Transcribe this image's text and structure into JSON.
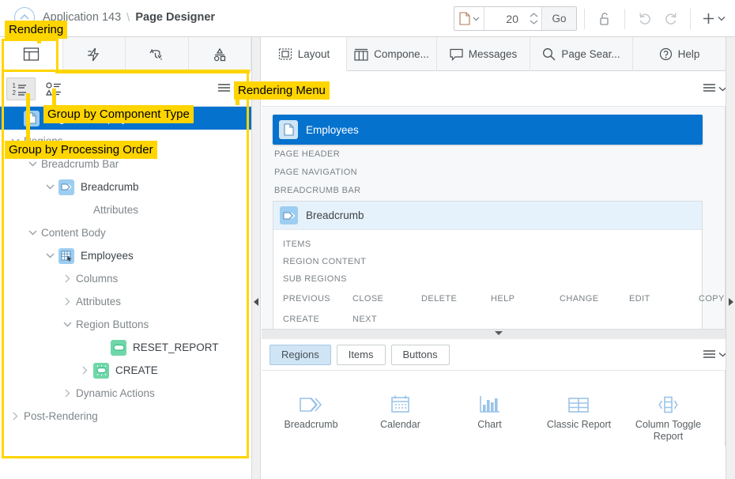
{
  "window": {
    "breadcrumb_app": "Application 143",
    "breadcrumb_sep": "\\",
    "breadcrumb_current": "Page Designer"
  },
  "toolbar": {
    "page_icon": "page-icon",
    "page_number": "20",
    "go_label": "Go",
    "lock_icon": "unlock-icon",
    "undo_icon": "undo-icon",
    "redo_icon": "redo-icon",
    "add_icon": "plus-icon"
  },
  "left_panel": {
    "tabs": [
      {
        "name": "rendering",
        "icon": "rendering-grid-icon",
        "active": true
      },
      {
        "name": "dynamic-actions",
        "icon": "lightning-icon",
        "active": false
      },
      {
        "name": "processing",
        "icon": "process-arrows-icon",
        "active": false
      },
      {
        "name": "page-shared-components",
        "icon": "shapes-icon",
        "active": false
      }
    ],
    "toolbar": {
      "group_processing_order_icon": "ordered-list-icon",
      "group_component_type_icon": "shapes-list-icon",
      "menu_icon": "hamburger-menu-icon"
    },
    "tree": [
      {
        "label": "Page 20: Employees",
        "indent": 0,
        "toggle": "none",
        "icon": "page-icon",
        "icon_color": "blue",
        "selected": true,
        "dark": true
      },
      {
        "label": "Regions",
        "indent": 0,
        "toggle": "down",
        "icon": "none",
        "icon_color": "plain",
        "selected": false,
        "dark": false
      },
      {
        "label": "Breadcrumb Bar",
        "indent": 1,
        "toggle": "down",
        "icon": "none",
        "icon_color": "plain",
        "selected": false,
        "dark": false
      },
      {
        "label": "Breadcrumb",
        "indent": 2,
        "toggle": "down",
        "icon": "breadcrumb-icon",
        "icon_color": "blue",
        "selected": false,
        "dark": true
      },
      {
        "label": "Attributes",
        "indent": 4,
        "toggle": "none",
        "icon": "none",
        "icon_color": "plain",
        "selected": false,
        "dark": false
      },
      {
        "label": "Content Body",
        "indent": 1,
        "toggle": "down",
        "icon": "none",
        "icon_color": "plain",
        "selected": false,
        "dark": false
      },
      {
        "label": "Employees",
        "indent": 2,
        "toggle": "down",
        "icon": "report-icon",
        "icon_color": "blue",
        "selected": false,
        "dark": true
      },
      {
        "label": "Columns",
        "indent": 3,
        "toggle": "right",
        "icon": "none",
        "icon_color": "plain",
        "selected": false,
        "dark": false
      },
      {
        "label": "Attributes",
        "indent": 3,
        "toggle": "right",
        "icon": "none",
        "icon_color": "plain",
        "selected": false,
        "dark": false
      },
      {
        "label": "Region Buttons",
        "indent": 3,
        "toggle": "down",
        "icon": "none",
        "icon_color": "plain",
        "selected": false,
        "dark": false
      },
      {
        "label": "RESET_REPORT",
        "indent": 5,
        "toggle": "none",
        "icon": "button-icon",
        "icon_color": "green",
        "selected": false,
        "dark": true
      },
      {
        "label": "CREATE",
        "indent": 4,
        "toggle": "right",
        "icon": "button-hot-icon",
        "icon_color": "green",
        "selected": false,
        "dark": true
      },
      {
        "label": "Dynamic Actions",
        "indent": 3,
        "toggle": "right",
        "icon": "none",
        "icon_color": "plain",
        "selected": false,
        "dark": false
      },
      {
        "label": "Post-Rendering",
        "indent": 0,
        "toggle": "right",
        "icon": "none",
        "icon_color": "plain",
        "selected": false,
        "dark": false
      }
    ]
  },
  "right_panel": {
    "tabs": [
      {
        "label": "Layout",
        "icon": "layout-icon",
        "active": true
      },
      {
        "label": "Compone...",
        "icon": "components-icon",
        "active": false
      },
      {
        "label": "Messages",
        "icon": "message-icon",
        "active": false
      },
      {
        "label": "Page Sear...",
        "icon": "search-icon",
        "active": false
      },
      {
        "label": "Help",
        "icon": "help-icon",
        "active": false
      }
    ],
    "toolbar": {
      "expand_icon": "expand-diagonal-icon",
      "menu_icon": "hamburger-menu-icon"
    },
    "layout": {
      "page_region_label": "Employees",
      "page_region_icon": "page-icon",
      "slots_before": [
        "PAGE HEADER",
        "PAGE NAVIGATION",
        "BREADCRUMB BAR"
      ],
      "subregion": {
        "label": "Breadcrumb",
        "icon": "breadcrumb-icon",
        "slots": [
          "ITEMS",
          "REGION CONTENT",
          "SUB REGIONS"
        ],
        "button_rows": [
          [
            "PREVIOUS",
            "CLOSE",
            "DELETE",
            "HELP",
            "CHANGE",
            "EDIT",
            "COPY"
          ],
          [
            "CREATE",
            "NEXT"
          ]
        ]
      }
    },
    "gallery": {
      "tabs": [
        {
          "label": "Regions",
          "selected": true
        },
        {
          "label": "Items",
          "selected": false
        },
        {
          "label": "Buttons",
          "selected": false
        }
      ],
      "menu_icon": "hamburger-menu-icon",
      "items": [
        {
          "label": "Breadcrumb",
          "icon": "breadcrumb-icon"
        },
        {
          "label": "Calendar",
          "icon": "calendar-icon"
        },
        {
          "label": "Chart",
          "icon": "chart-icon"
        },
        {
          "label": "Classic Report",
          "icon": "table-icon"
        },
        {
          "label": "Column Toggle Report",
          "icon": "column-toggle-icon"
        }
      ]
    }
  },
  "callouts": [
    {
      "id": "rendering",
      "text": "Rendering"
    },
    {
      "id": "rendering-menu",
      "text": "Rendering Menu"
    },
    {
      "id": "group-component-type",
      "text": "Group by Component Type"
    },
    {
      "id": "group-processing-order",
      "text": "Group by Processing Order"
    }
  ],
  "colors": {
    "highlight": "#ffd500",
    "selection_blue": "#0572ce",
    "icon_blue": "#9dcdf0",
    "icon_green": "#6fd6a8"
  }
}
